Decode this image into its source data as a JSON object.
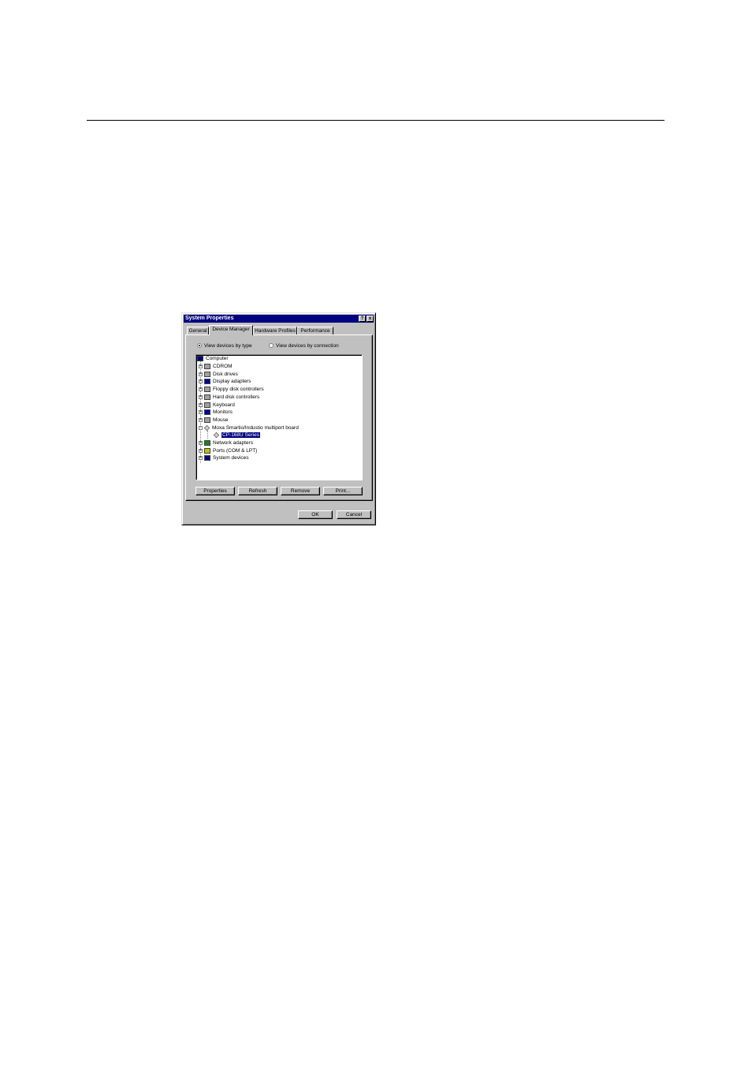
{
  "dialog": {
    "title": "System Properties",
    "help_button": "?",
    "close_button": "x",
    "tabs": [
      {
        "label": "General"
      },
      {
        "label": "Device Manager"
      },
      {
        "label": "Hardware Profiles"
      },
      {
        "label": "Performance"
      }
    ],
    "active_tab": "Device Manager",
    "view_options": [
      {
        "label": "View devices by type",
        "selected": true
      },
      {
        "label": "View devices by connection",
        "selected": false
      }
    ],
    "tree": [
      {
        "label": "Computer",
        "icon": "computer-icon",
        "level": 0
      },
      {
        "label": "CDROM",
        "icon": "cdrom-icon",
        "level": 1,
        "expander": "+"
      },
      {
        "label": "Disk drives",
        "icon": "disk-drive-icon",
        "level": 1,
        "expander": "+"
      },
      {
        "label": "Display adapters",
        "icon": "display-adapter-icon",
        "level": 1,
        "expander": "+"
      },
      {
        "label": "Floppy disk controllers",
        "icon": "floppy-controller-icon",
        "level": 1,
        "expander": "+"
      },
      {
        "label": "Hard disk controllers",
        "icon": "hard-disk-controller-icon",
        "level": 1,
        "expander": "+"
      },
      {
        "label": "Keyboard",
        "icon": "keyboard-icon",
        "level": 1,
        "expander": "+"
      },
      {
        "label": "Monitors",
        "icon": "monitor-icon",
        "level": 1,
        "expander": "+"
      },
      {
        "label": "Mouse",
        "icon": "mouse-icon",
        "level": 1,
        "expander": "+"
      },
      {
        "label": "Moxa Smartio/Industio multiport board",
        "icon": "multiport-board-icon",
        "level": 1,
        "expander": "-"
      },
      {
        "label": "CP-168U Series",
        "icon": "multiport-board-icon",
        "level": 2,
        "selected": true
      },
      {
        "label": "Network adapters",
        "icon": "network-adapter-icon",
        "level": 1,
        "expander": "+"
      },
      {
        "label": "Ports (COM & LPT)",
        "icon": "ports-icon",
        "level": 1,
        "expander": "+"
      },
      {
        "label": "System devices",
        "icon": "system-devices-icon",
        "level": 1,
        "expander": "+"
      }
    ],
    "panel_buttons": {
      "properties": "Properties",
      "refresh": "Refresh",
      "remove": "Remove",
      "print": "Print..."
    },
    "ok_label": "OK",
    "cancel_label": "Cancel"
  }
}
